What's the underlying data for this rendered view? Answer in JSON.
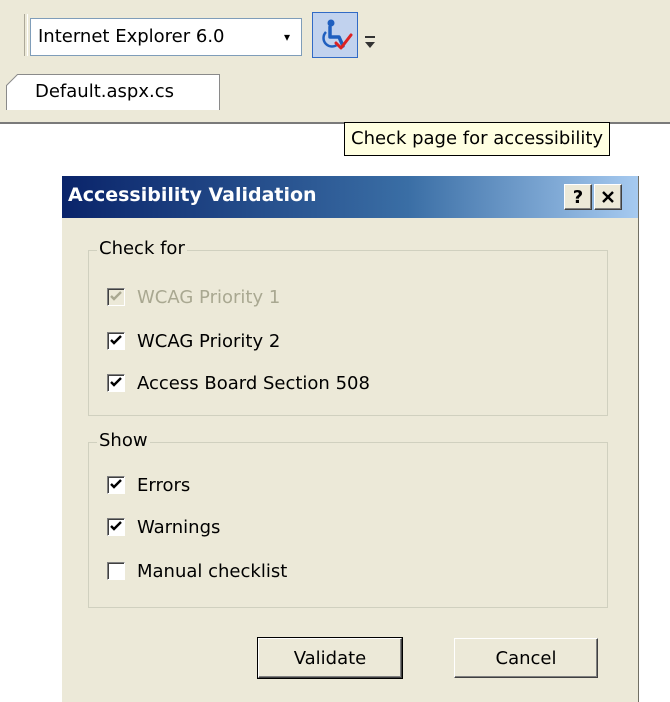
{
  "toolbar": {
    "browser_target": "Internet Explorer 6.0",
    "dropdown_arrow": "▾",
    "check_button_icon": "accessibility-check-icon",
    "overflow_icon": "toolbar-overflow-chevron-icon"
  },
  "tabs": {
    "active": "Default.aspx.cs"
  },
  "tooltip": {
    "text": "Check page for accessibility"
  },
  "dialog": {
    "title": "Accessibility Validation",
    "help_label": "?",
    "close_label": "✕",
    "check_for": {
      "legend": "Check for",
      "options": [
        {
          "label": "WCAG Priority 1",
          "checked": true,
          "enabled": false
        },
        {
          "label": "WCAG Priority 2",
          "checked": true,
          "enabled": true
        },
        {
          "label": "Access Board Section 508",
          "checked": true,
          "enabled": true
        }
      ]
    },
    "show": {
      "legend": "Show",
      "options": [
        {
          "label": "Errors",
          "checked": true,
          "enabled": true
        },
        {
          "label": "Warnings",
          "checked": true,
          "enabled": true
        },
        {
          "label": "Manual checklist",
          "checked": false,
          "enabled": true
        }
      ]
    },
    "validate_label": "Validate",
    "cancel_label": "Cancel"
  },
  "colors": {
    "titlebar_start": "#0a246a",
    "titlebar_end": "#a6caf0",
    "dialog_face": "#ece9d8",
    "tooltip_bg": "#ffffe1",
    "check_mark": "#000000",
    "disabled_text": "#a9a891"
  }
}
